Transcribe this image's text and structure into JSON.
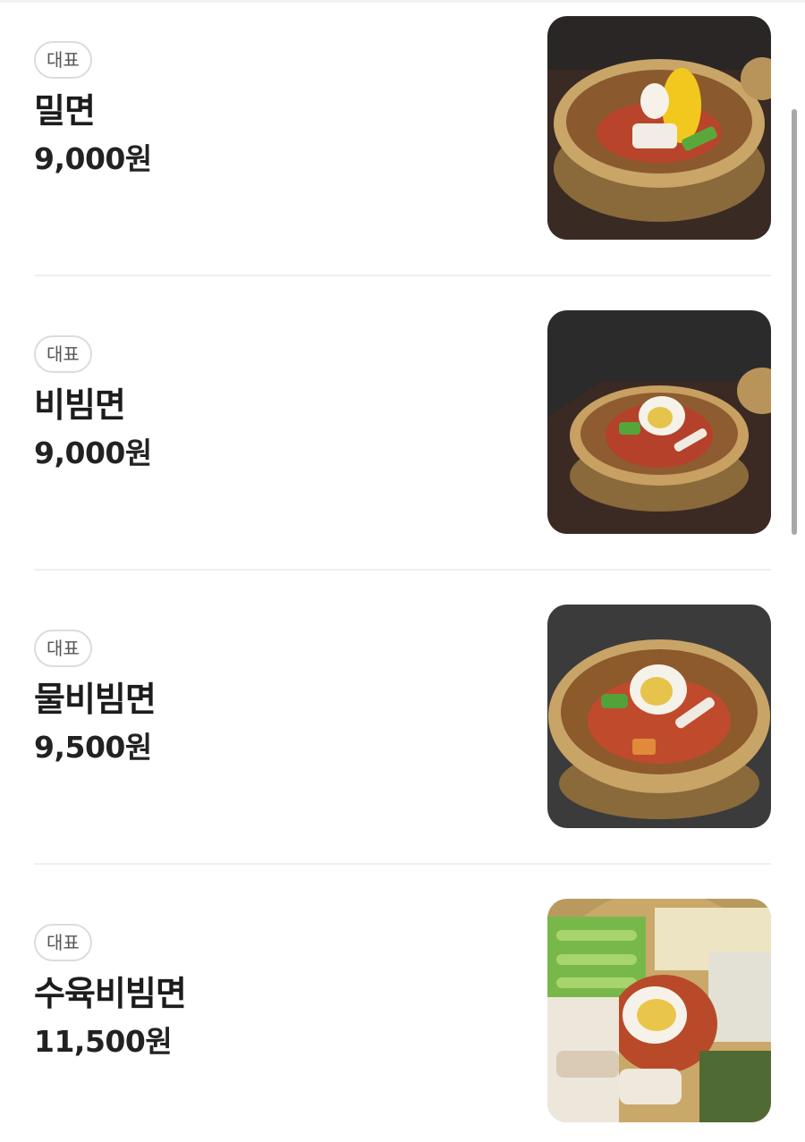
{
  "menu": {
    "items": [
      {
        "badge": "대표",
        "name": "밀면",
        "price": "9,000원",
        "image": "mil-myeon-photo"
      },
      {
        "badge": "대표",
        "name": "비빔면",
        "price": "9,000원",
        "image": "bibim-myeon-photo"
      },
      {
        "badge": "대표",
        "name": "물비빔면",
        "price": "9,500원",
        "image": "mul-bibim-myeon-photo"
      },
      {
        "badge": "대표",
        "name": "수육비빔면",
        "price": "11,500원",
        "image": "suyuk-bibim-myeon-photo"
      }
    ]
  },
  "colors": {
    "badge_border": "#dcdcdc",
    "text": "#1c1c1c",
    "divider": "#efefef",
    "scrollbar": "#a8a8a8"
  }
}
